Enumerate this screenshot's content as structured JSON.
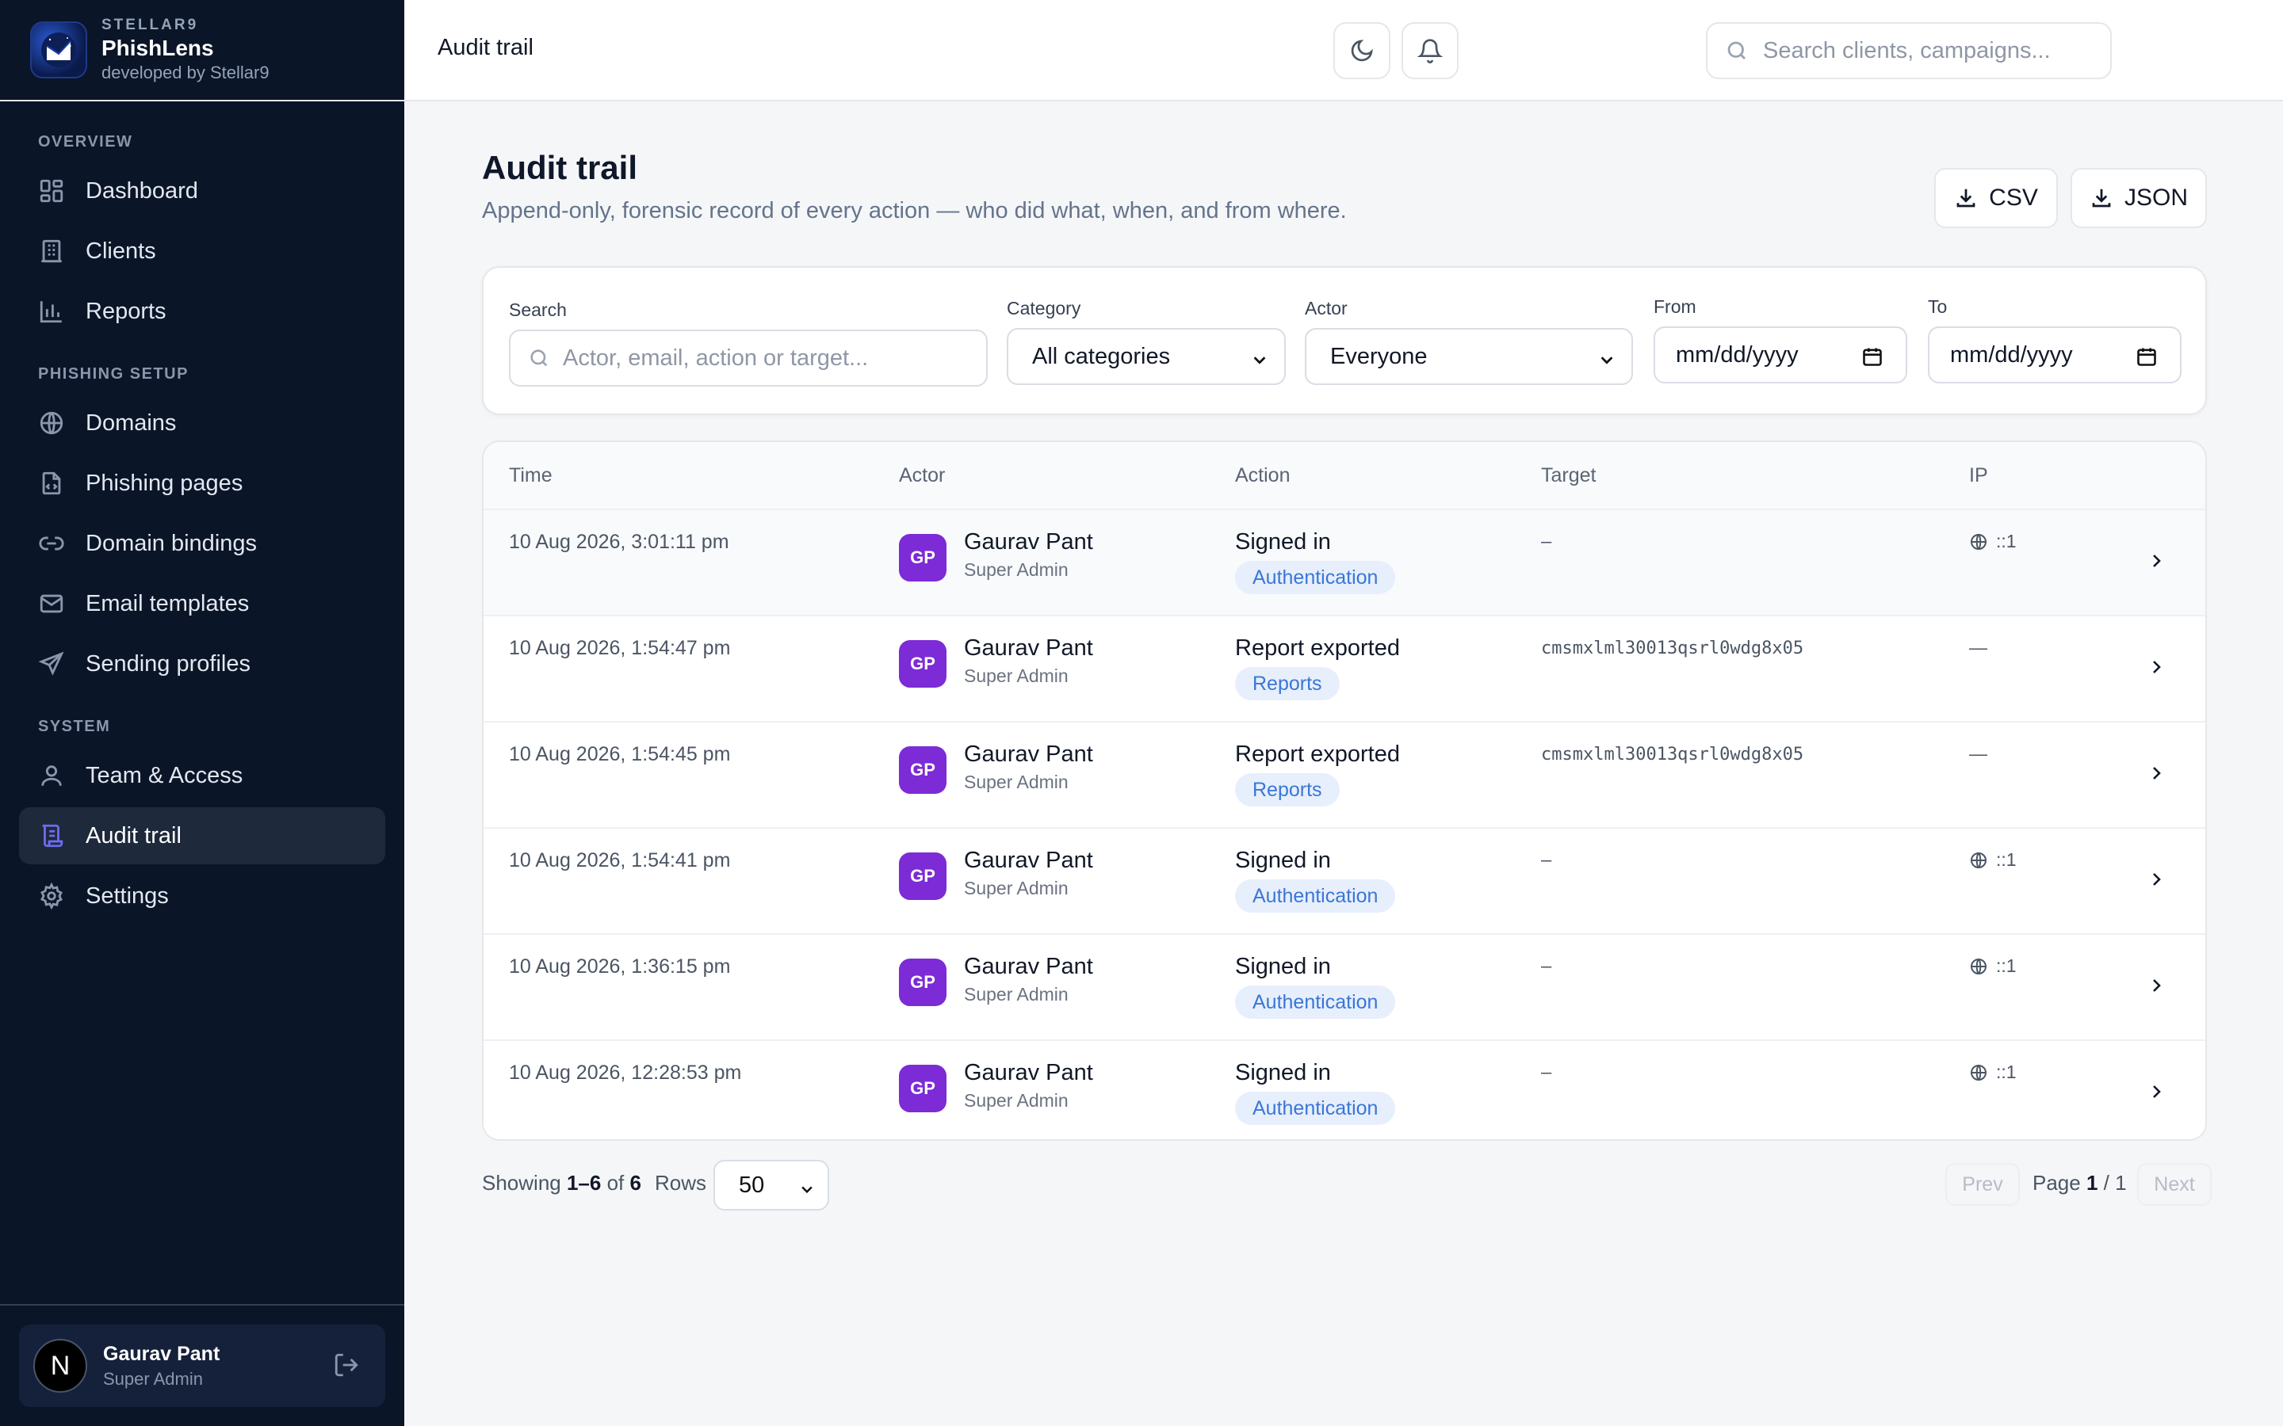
{
  "brand": {
    "org": "STELLAR9",
    "app": "PhishLens",
    "by": "developed by Stellar9"
  },
  "nav": {
    "sections": [
      {
        "title": "OVERVIEW",
        "items": [
          {
            "label": "Dashboard",
            "icon": "dashboard-icon"
          },
          {
            "label": "Clients",
            "icon": "building-icon"
          },
          {
            "label": "Reports",
            "icon": "bar-chart-icon"
          }
        ]
      },
      {
        "title": "PHISHING SETUP",
        "items": [
          {
            "label": "Domains",
            "icon": "globe-icon"
          },
          {
            "label": "Phishing pages",
            "icon": "file-code-icon"
          },
          {
            "label": "Domain bindings",
            "icon": "link-icon"
          },
          {
            "label": "Email templates",
            "icon": "mail-icon"
          },
          {
            "label": "Sending profiles",
            "icon": "send-icon"
          }
        ]
      },
      {
        "title": "SYSTEM",
        "items": [
          {
            "label": "Team & Access",
            "icon": "user-icon"
          },
          {
            "label": "Audit trail",
            "icon": "scroll-icon",
            "active": true
          },
          {
            "label": "Settings",
            "icon": "gear-icon"
          }
        ]
      }
    ]
  },
  "user": {
    "initial": "N",
    "name": "Gaurav Pant",
    "role": "Super Admin"
  },
  "topbar": {
    "title": "Audit trail",
    "search_placeholder": "Search clients, campaigns..."
  },
  "page": {
    "title": "Audit trail",
    "subtitle": "Append-only, forensic record of every action — who did what, when, and from where.",
    "csv_label": "CSV",
    "json_label": "JSON"
  },
  "filters": {
    "search_label": "Search",
    "search_placeholder": "Actor, email, action or target...",
    "category_label": "Category",
    "category_value": "All categories",
    "actor_label": "Actor",
    "actor_value": "Everyone",
    "from_label": "From",
    "from_placeholder": "mm/dd/yyyy",
    "to_label": "To",
    "to_placeholder": "mm/dd/yyyy"
  },
  "table": {
    "columns": [
      "Time",
      "Actor",
      "Action",
      "Target",
      "IP"
    ],
    "rows": [
      {
        "time": "10 Aug 2026, 3:01:11 pm",
        "initials": "GP",
        "actor": "Gaurav Pant",
        "role": "Super Admin",
        "action": "Signed in",
        "category": "Authentication",
        "target": "–",
        "ip": "::1"
      },
      {
        "time": "10 Aug 2026, 1:54:47 pm",
        "initials": "GP",
        "actor": "Gaurav Pant",
        "role": "Super Admin",
        "action": "Report exported",
        "category": "Reports",
        "target": "cmsmxlml30013qsrl0wdg8x05",
        "ip": "—"
      },
      {
        "time": "10 Aug 2026, 1:54:45 pm",
        "initials": "GP",
        "actor": "Gaurav Pant",
        "role": "Super Admin",
        "action": "Report exported",
        "category": "Reports",
        "target": "cmsmxlml30013qsrl0wdg8x05",
        "ip": "—"
      },
      {
        "time": "10 Aug 2026, 1:54:41 pm",
        "initials": "GP",
        "actor": "Gaurav Pant",
        "role": "Super Admin",
        "action": "Signed in",
        "category": "Authentication",
        "target": "–",
        "ip": "::1"
      },
      {
        "time": "10 Aug 2026, 1:36:15 pm",
        "initials": "GP",
        "actor": "Gaurav Pant",
        "role": "Super Admin",
        "action": "Signed in",
        "category": "Authentication",
        "target": "–",
        "ip": "::1"
      },
      {
        "time": "10 Aug 2026, 12:28:53 pm",
        "initials": "GP",
        "actor": "Gaurav Pant",
        "role": "Super Admin",
        "action": "Signed in",
        "category": "Authentication",
        "target": "–",
        "ip": "::1"
      }
    ]
  },
  "footer": {
    "showing_prefix": "Showing",
    "range": "1–6",
    "of": "of",
    "total": "6",
    "rows_label": "Rows",
    "rows_value": "50",
    "prev": "Prev",
    "page_prefix": "Page",
    "page_current": "1",
    "page_sep": "/ 1",
    "next": "Next"
  },
  "colors": {
    "sidebar_bg": "#0b1528",
    "accent": "#6d6cf0",
    "avatar": "#7c2bd6",
    "pill_bg": "#e7effc",
    "pill_text": "#3a76d8"
  }
}
